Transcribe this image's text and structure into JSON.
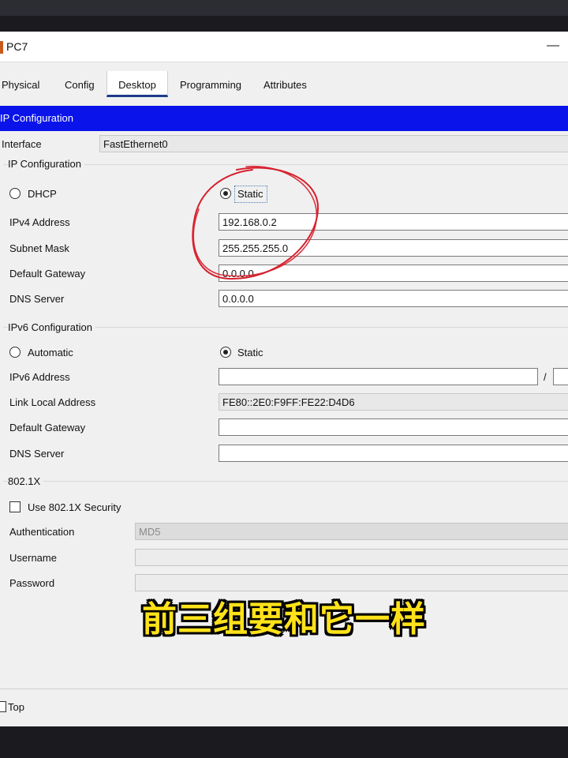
{
  "window": {
    "title": "PC7",
    "minimize_glyph": "—"
  },
  "tabs": [
    {
      "label": "Physical"
    },
    {
      "label": "Config"
    },
    {
      "label": "Desktop"
    },
    {
      "label": "Programming"
    },
    {
      "label": "Attributes"
    }
  ],
  "active_tab": "Desktop",
  "panel": {
    "header": "IP Configuration",
    "interface_label": "Interface",
    "interface_value": "FastEthernet0"
  },
  "ipv4": {
    "section_title": "IP Configuration",
    "dhcp_label": "DHCP",
    "static_label": "Static",
    "mode": "Static",
    "ipv4_address_label": "IPv4 Address",
    "ipv4_address": "192.168.0.2",
    "subnet_mask_label": "Subnet Mask",
    "subnet_mask": "255.255.255.0",
    "default_gateway_label": "Default Gateway",
    "default_gateway": "0.0.0.0",
    "dns_server_label": "DNS Server",
    "dns_server": "0.0.0.0"
  },
  "ipv6": {
    "section_title": "IPv6 Configuration",
    "automatic_label": "Automatic",
    "static_label": "Static",
    "mode": "Static",
    "ipv6_address_label": "IPv6 Address",
    "ipv6_address": "",
    "prefix_separator": "/",
    "prefix_length": "",
    "link_local_label": "Link Local Address",
    "link_local": "FE80::2E0:F9FF:FE22:D4D6",
    "default_gateway_label": "Default Gateway",
    "default_gateway": "",
    "dns_server_label": "DNS Server",
    "dns_server": ""
  },
  "dot1x": {
    "section_title": "802.1X",
    "use_security_label": "Use 802.1X Security",
    "use_security": false,
    "authentication_label": "Authentication",
    "authentication": "MD5",
    "username_label": "Username",
    "username": "",
    "password_label": "Password",
    "password": ""
  },
  "statusbar": {
    "top_label": "Top",
    "top_checked": false
  },
  "caption": "前三组要和它一样",
  "colors": {
    "header_bg": "#0a14ea",
    "tab_underline": "#1c3b8a",
    "annotation": "#d61f2c",
    "caption": "#ffe21a"
  }
}
